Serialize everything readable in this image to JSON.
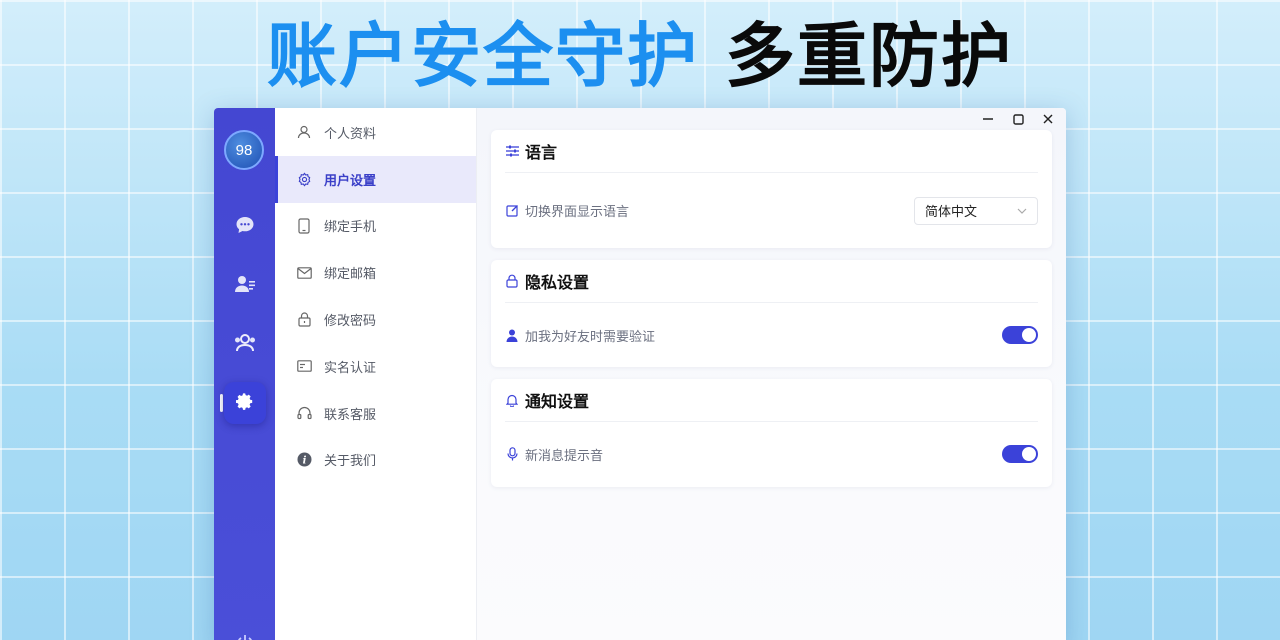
{
  "headline": {
    "part_blue": "账户安全守护",
    "part_black": "多重防护"
  },
  "rail": {
    "avatar_text": "98",
    "items": [
      {
        "icon": "chat-icon"
      },
      {
        "icon": "contact-card-icon"
      },
      {
        "icon": "group-icon"
      },
      {
        "icon": "gear-icon",
        "active": true
      }
    ],
    "bottom_icon": "power-icon"
  },
  "nav": {
    "items": [
      {
        "label": "个人资料",
        "icon": "user-icon"
      },
      {
        "label": "用户设置",
        "icon": "settings-icon",
        "active": true
      },
      {
        "label": "绑定手机",
        "icon": "phone-icon"
      },
      {
        "label": "绑定邮箱",
        "icon": "mail-icon"
      },
      {
        "label": "修改密码",
        "icon": "lock-icon"
      },
      {
        "label": "实名认证",
        "icon": "id-card-icon"
      },
      {
        "label": "联系客服",
        "icon": "headset-icon"
      },
      {
        "label": "关于我们",
        "icon": "info-icon"
      }
    ]
  },
  "window_controls": {
    "minimize": "minimize-icon",
    "maximize": "maximize-icon",
    "close": "close-icon"
  },
  "language_card": {
    "title": "语言",
    "row_label": "切换界面显示语言",
    "select_value": "简体中文"
  },
  "privacy_card": {
    "title": "隐私设置",
    "row_label": "加我为好友时需要验证",
    "toggle_on": true
  },
  "notify_card": {
    "title": "通知设置",
    "row_label": "新消息提示音",
    "toggle_on": true
  },
  "colors": {
    "accent": "#3b42d9",
    "headline_blue": "#1c8ff0",
    "rail": "#4447d2"
  }
}
